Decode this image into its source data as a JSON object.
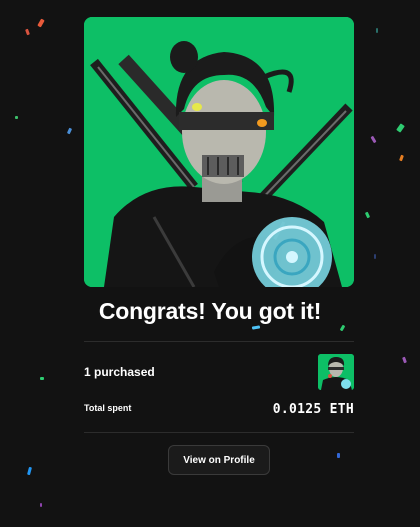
{
  "dialog": {
    "title": "Congrats! You got it!",
    "purchased_text": "1 purchased",
    "total_spent_label": "Total spent",
    "total_spent_value": "0.0125 ETH",
    "view_button_label": "View on Profile"
  },
  "colors": {
    "background": "#121212",
    "artwork_background": "#0dbf66",
    "divider": "#2c2c2c"
  }
}
